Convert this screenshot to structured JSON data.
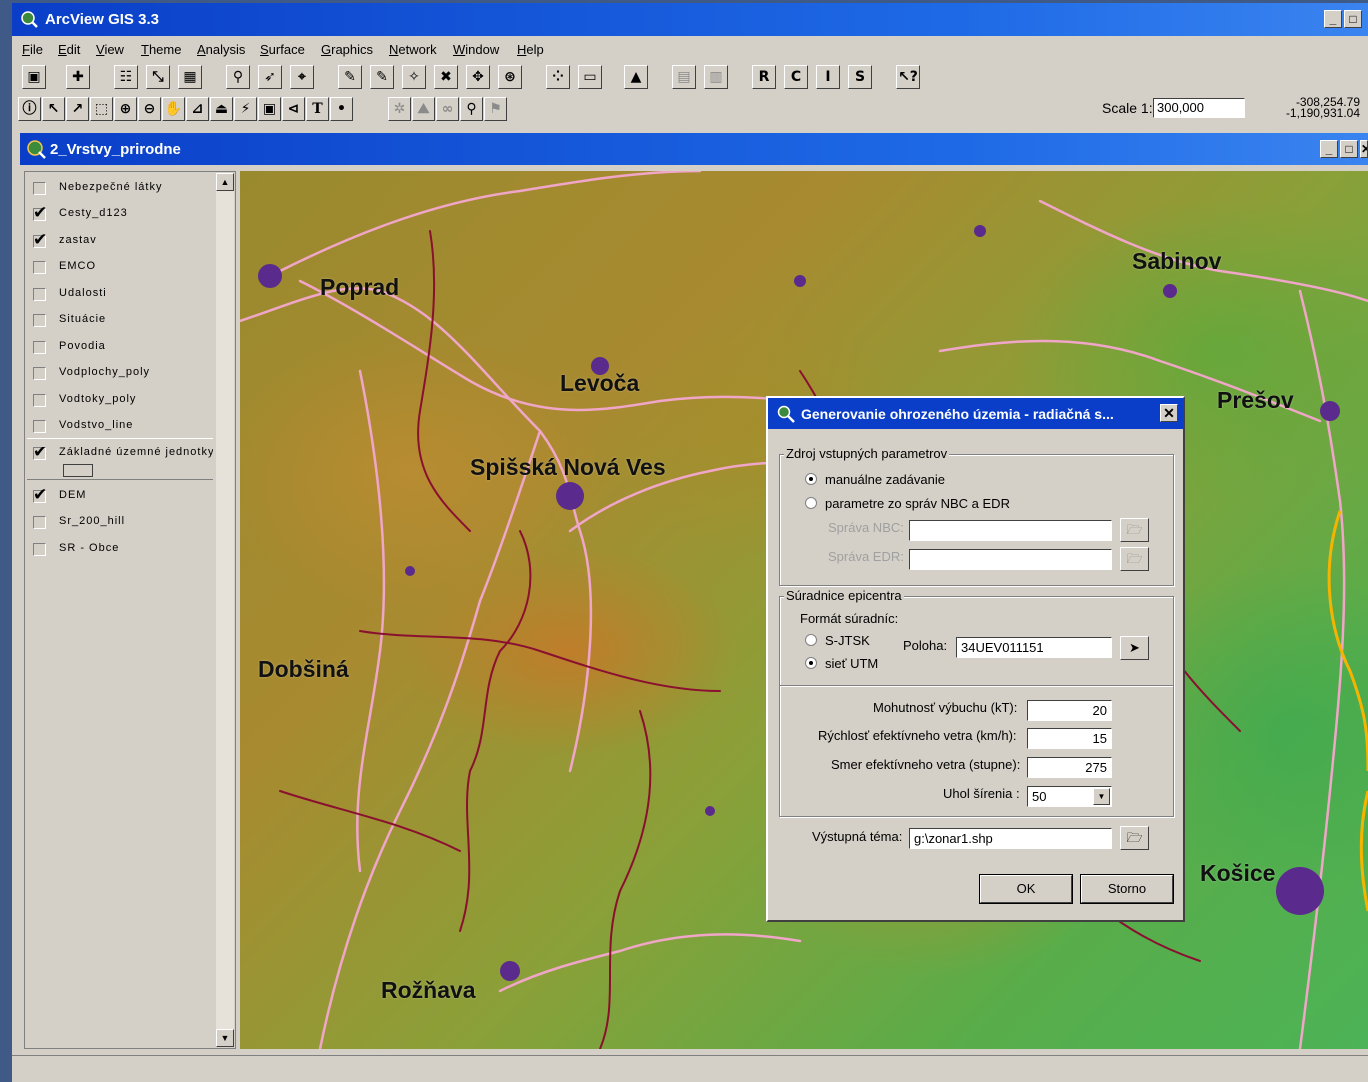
{
  "app": {
    "title": "ArcView GIS 3.3"
  },
  "menu": [
    "File",
    "Edit",
    "View",
    "Theme",
    "Analysis",
    "Surface",
    "Graphics",
    "Network",
    "Window",
    "Help"
  ],
  "toolbar": {
    "letter_buttons": [
      "R",
      "C",
      "I",
      "S"
    ],
    "text_tool": "T",
    "help_button": "❓"
  },
  "scale": {
    "label": "Scale 1:",
    "value": "300,000"
  },
  "coords": {
    "x": "-308,254.79",
    "y": "-1,190,931.04"
  },
  "view": {
    "title": "2_Vrstvy_prirodne"
  },
  "toc": [
    {
      "label": "Nebezpečné látky",
      "checked": false
    },
    {
      "label": "Cesty_d123",
      "checked": true
    },
    {
      "label": "zastav",
      "checked": true
    },
    {
      "label": "EMCO",
      "checked": false
    },
    {
      "label": "Udalosti",
      "checked": false
    },
    {
      "label": "Situácie",
      "checked": false
    },
    {
      "label": "Povodia",
      "checked": false
    },
    {
      "label": "Vodplochy_poly",
      "checked": false
    },
    {
      "label": "Vodtoky_poly",
      "checked": false
    },
    {
      "label": "Vodstvo_line",
      "checked": false
    },
    {
      "label": "Základné územné jednotky",
      "checked": true
    },
    {
      "label": "DEM",
      "checked": true
    },
    {
      "label": "Sr_200_hill",
      "checked": false
    },
    {
      "label": "SR - Obce",
      "checked": false
    }
  ],
  "map": {
    "cities": [
      "Poprad",
      "Levoča",
      "Sabinov",
      "Prešov",
      "Spišská Nová Ves",
      "Dobšiná",
      "Košice",
      "Rožňava"
    ]
  },
  "dialog": {
    "title": "Generovanie ohrozeného územia - radiačná s...",
    "close": "✕",
    "source_group": "Zdroj vstupných parametrov",
    "radio_manual": "manuálne zadávanie",
    "radio_reports": "parametre zo správ NBC a EDR",
    "nbc_label": "Správa NBC:",
    "edr_label": "Správa EDR:",
    "coord_group": "Súradnice epicentra",
    "format_label": "Formát súradníc:",
    "radio_sjtsk": "S-JTSK",
    "radio_utm": "sieť UTM",
    "position_label": "Poloha:",
    "position_value": "34UEV011151",
    "yield_label": "Mohutnosť výbuchu (kT):",
    "yield_value": "20",
    "wind_speed_label": "Rýchlosť efektívneho vetra (km/h):",
    "wind_speed_value": "15",
    "wind_dir_label": "Smer efektívneho vetra (stupne):",
    "wind_dir_value": "275",
    "spread_label": "Uhol šírenia :",
    "spread_value": "50",
    "output_label": "Výstupná téma:",
    "output_value": "g:\\zonar1.shp",
    "ok": "OK",
    "cancel": "Storno"
  }
}
